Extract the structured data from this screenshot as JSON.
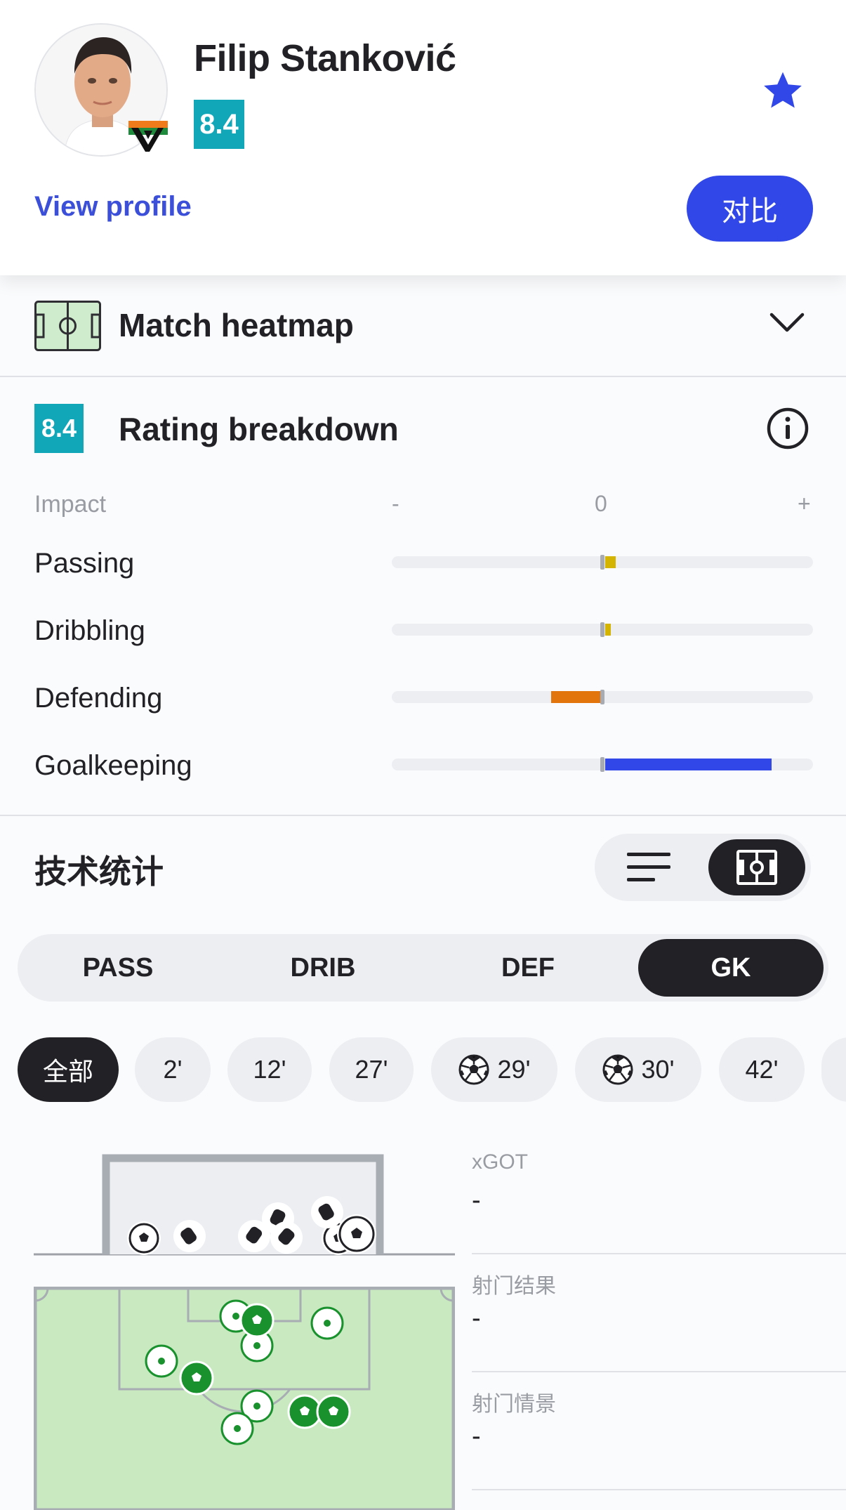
{
  "player": {
    "name": "Filip Stanković",
    "rating": "8.4",
    "favorite_icon": "star-icon",
    "view_profile_label": "View profile",
    "compare_label": "对比",
    "accent_color": "#3147e8",
    "rating_color": "#11a6b8"
  },
  "heatmap": {
    "title": "Match heatmap",
    "icon": "pitch-icon",
    "expand_icon": "chevron-down-icon"
  },
  "breakdown": {
    "title": "Rating breakdown",
    "rating": "8.4",
    "header": {
      "label": "Impact",
      "minus": "-",
      "zero": "0",
      "plus": "+"
    },
    "categories": [
      {
        "label": "Passing",
        "value": 0.05,
        "color": "#d4b400"
      },
      {
        "label": "Dribbling",
        "value": 0.02,
        "color": "#d4b400"
      },
      {
        "label": "Defending",
        "value": -0.24,
        "color": "#e2760c"
      },
      {
        "label": "Goalkeeping",
        "value": 0.81,
        "color": "#3147e8"
      }
    ]
  },
  "tech_stats": {
    "title": "技术统计",
    "view_options": [
      "list-icon",
      "pitch-icon"
    ],
    "active_view": 1,
    "tabs": [
      {
        "label": "PASS"
      },
      {
        "label": "DRIB"
      },
      {
        "label": "DEF"
      },
      {
        "label": "GK"
      }
    ],
    "active_tab": 3,
    "chips": [
      {
        "label": "全部",
        "active": true
      },
      {
        "label": "2'"
      },
      {
        "label": "12'"
      },
      {
        "label": "27'"
      },
      {
        "label": "29'",
        "icon": "goal-ball-icon"
      },
      {
        "label": "30'",
        "icon": "goal-ball-icon"
      },
      {
        "label": "42'"
      }
    ]
  },
  "shot_stats": [
    {
      "label": "xGOT",
      "value": "-"
    },
    {
      "label": "射门结果",
      "value": "-"
    },
    {
      "label": "射门情景",
      "value": "-"
    }
  ]
}
